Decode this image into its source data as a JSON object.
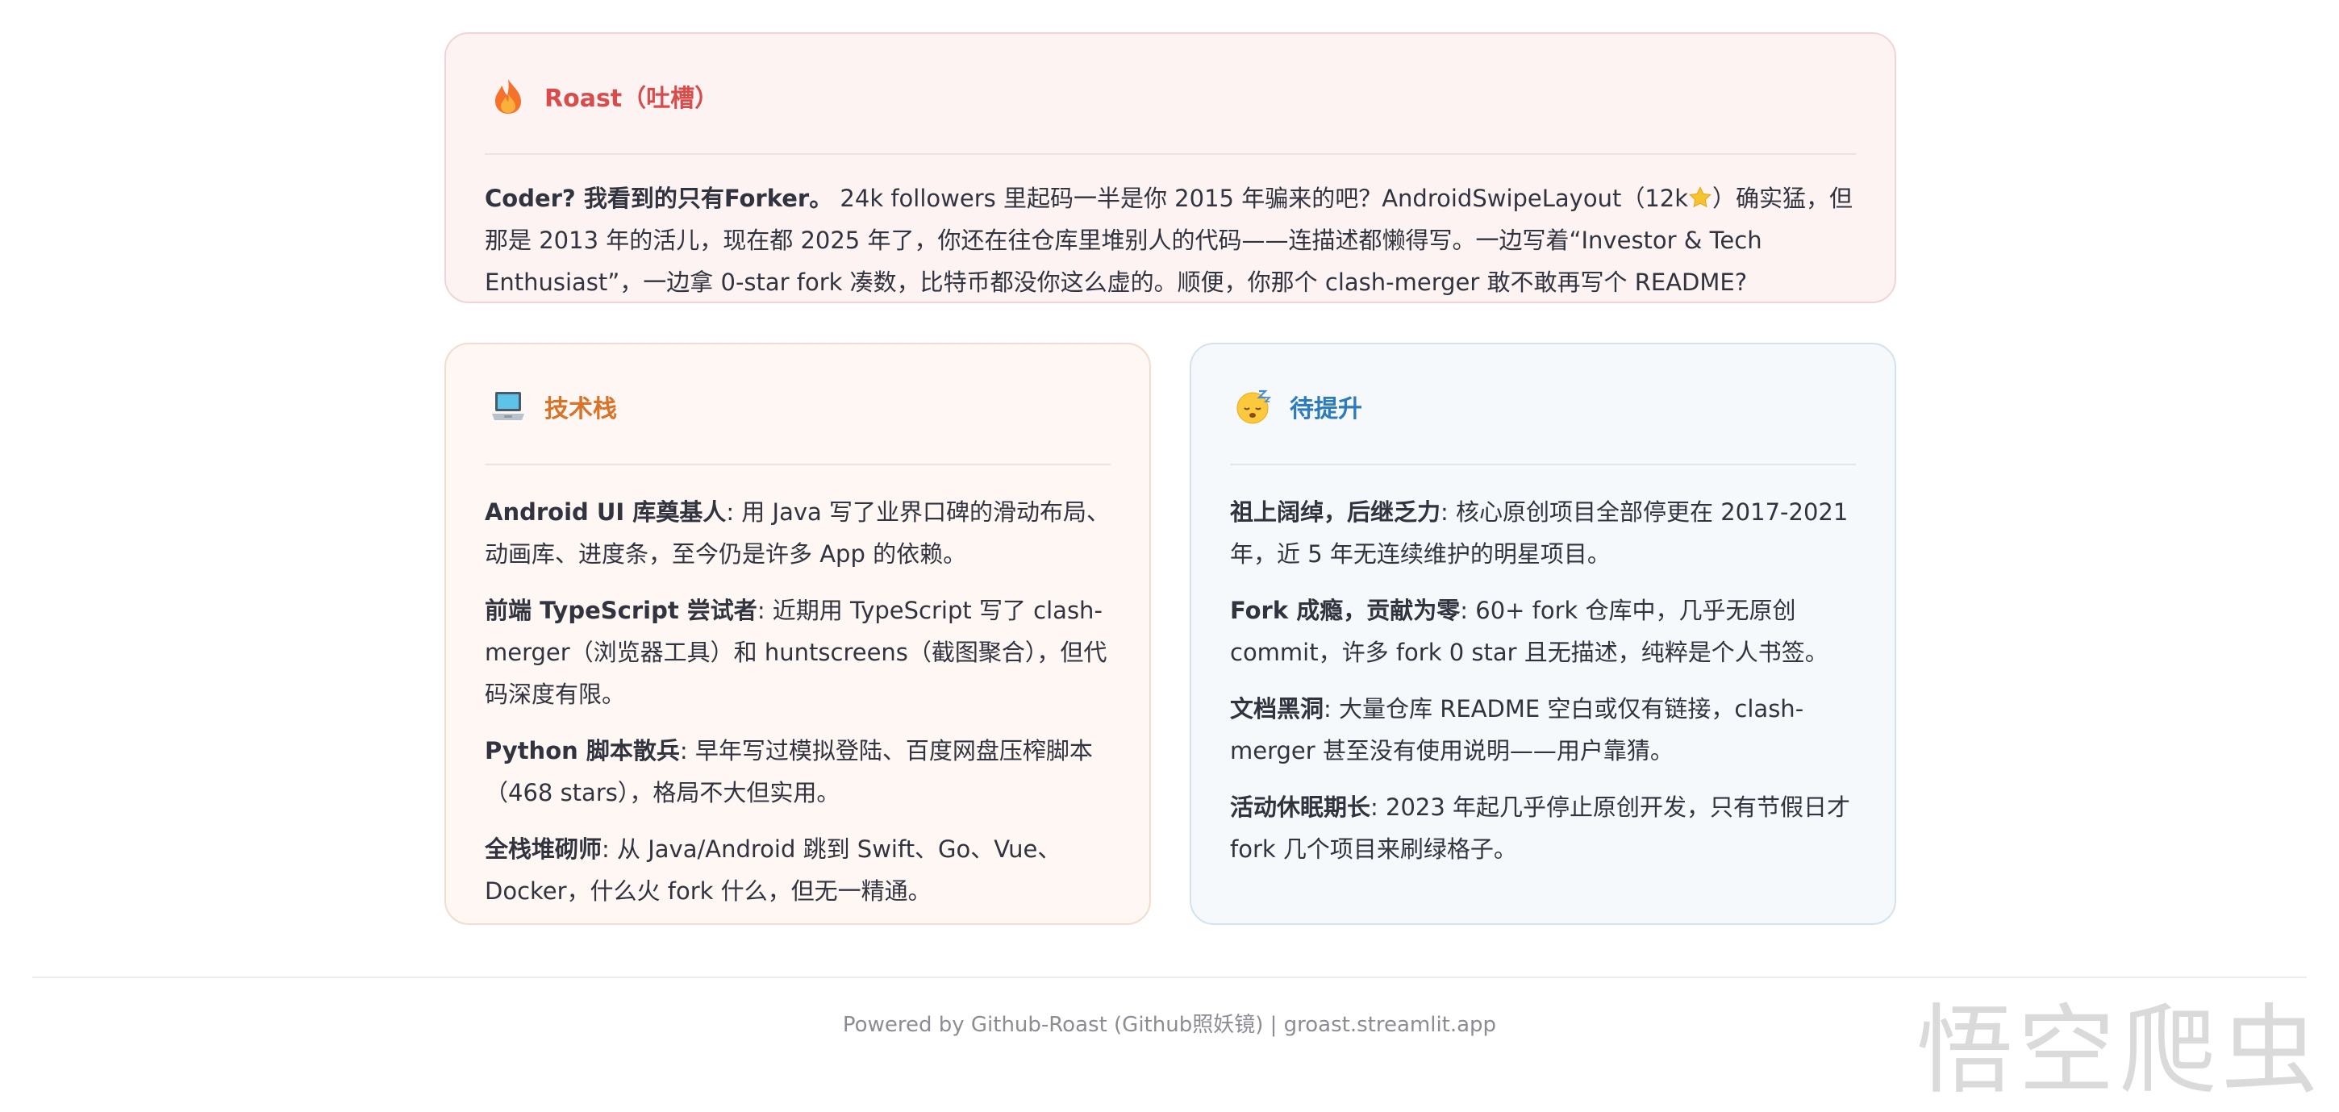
{
  "roast": {
    "title": "Roast（吐槽）",
    "icon": "fire-icon",
    "lead": "Coder? 我看到的只有Forker。",
    "text_before_star": " 24k followers 里起码一半是你 2015 年骗来的吧？AndroidSwipeLayout（12k",
    "text_after_star": "）确实猛，但那是 2013 年的活儿，现在都 2025 年了，你还在往仓库里堆别人的代码——连描述都懒得写。一边写着“Investor & Tech Enthusiast”，一边拿 0-star fork 凑数，比特币都没你这么虚的。顺便，你那个 clash-merger 敢不敢再写个 README?"
  },
  "tech": {
    "title": "技术栈",
    "icon": "laptop-icon",
    "items": [
      {
        "label": "Android UI 库奠基人",
        "text": ": 用 Java 写了业界口碑的滑动布局、动画库、进度条，至今仍是许多 App 的依赖。"
      },
      {
        "label": "前端 TypeScript 尝试者",
        "text": ": 近期用 TypeScript 写了 clash-merger（浏览器工具）和 huntscreens（截图聚合），但代码深度有限。"
      },
      {
        "label": "Python 脚本散兵",
        "text": ": 早年写过模拟登陆、百度网盘压榨脚本（468 stars），格局不大但实用。"
      },
      {
        "label": "全栈堆砌师",
        "text": ": 从 Java/Android 跳到 Swift、Go、Vue、Docker，什么火 fork 什么，但无一精通。"
      }
    ]
  },
  "improve": {
    "title": "待提升",
    "icon": "sleepy-face-icon",
    "items": [
      {
        "label": "祖上阔绰，后继乏力",
        "text": ": 核心原创项目全部停更在 2017-2021 年，近 5 年无连续维护的明星项目。"
      },
      {
        "label": "Fork 成瘾，贡献为零",
        "text": ": 60+ fork 仓库中，几乎无原创 commit，许多 fork 0 star 且无描述，纯粹是个人书签。"
      },
      {
        "label": "文档黑洞",
        "text": ": 大量仓库 README 空白或仅有链接，clash-merger 甚至没有使用说明——用户靠猜。"
      },
      {
        "label": "活动休眠期长",
        "text": ": 2023 年起几乎停止原创开发，只有节假日才 fork 几个项目来刷绿格子。"
      }
    ]
  },
  "footer": {
    "text": "Powered by Github-Roast (Github照妖镜) | groast.streamlit.app"
  },
  "watermark": {
    "text": "悟空爬虫"
  },
  "colors": {
    "roast_title": "#d84c4c",
    "tech_title": "#d8742a",
    "improve_title": "#2d7bbd",
    "roast_bg": "#fdf3f3",
    "tech_bg": "#fef7f4",
    "improve_bg": "#f6f9fc"
  }
}
